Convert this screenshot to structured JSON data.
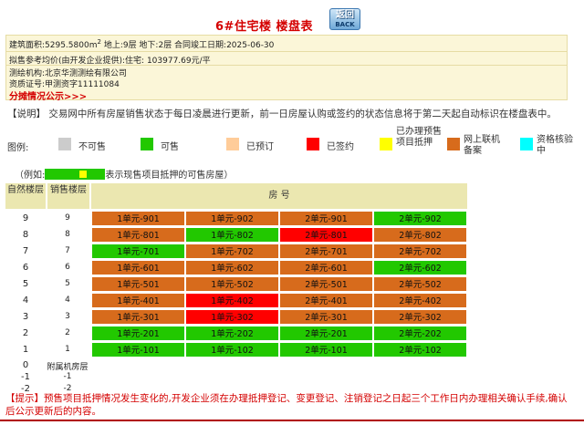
{
  "header": {
    "title": "6#住宅楼  楼盘表",
    "back_top": "返回",
    "back_bottom": "BACK"
  },
  "info": {
    "area_prefix": "建筑面积:5295.5800m",
    "area_sup": "2",
    "area_suffix": "  地上:9层  地下:2层  合同竣工日期:2025-06-30",
    "price": "拟售参考均价(由开发企业提供):住宅:  103977.69元/平",
    "agency": "测绘机构:北京华测测绘有限公司",
    "cert": "资质证号:甲测资字11111084",
    "link": "分摊情况公示>>>"
  },
  "note": "【说明】 交易网中所有房屋销售状态于每日凌晨进行更新，前一日房屋认购或签约的状态信息将于第二天起自动标识在楼盘表中。",
  "legend": {
    "label": "图例:",
    "items": [
      {
        "name": "不可售",
        "color": "#cccccc"
      },
      {
        "name": "可售",
        "color": "#22c800"
      },
      {
        "name": "已预订",
        "color": "#ffcc99"
      },
      {
        "name": "已签约",
        "color": "#ff0000"
      },
      {
        "name": "已办理预售项目抵押",
        "color": "#ffff00"
      },
      {
        "name": "网上联机备案",
        "color": "#d76b1c"
      },
      {
        "name": "资格核验中",
        "color": "#00ffff"
      }
    ]
  },
  "example": {
    "prefix": "（例如:",
    "suffix": "表示现售项目抵押的可售房屋）"
  },
  "table": {
    "headers": {
      "floor": "自然楼层",
      "sales": "销售楼层",
      "rooms": "房 号"
    },
    "rows": [
      {
        "floor": "9",
        "sales": "9",
        "cells": [
          {
            "label": "1单元-901",
            "status": "sold"
          },
          {
            "label": "1单元-902",
            "status": "sold"
          },
          {
            "label": "2单元-901",
            "status": "sold"
          },
          {
            "label": "2单元-902",
            "status": "avail"
          }
        ]
      },
      {
        "floor": "8",
        "sales": "8",
        "cells": [
          {
            "label": "1单元-801",
            "status": "sold"
          },
          {
            "label": "1单元-802",
            "status": "avail"
          },
          {
            "label": "2单元-801",
            "status": "signed"
          },
          {
            "label": "2单元-802",
            "status": "sold"
          }
        ]
      },
      {
        "floor": "7",
        "sales": "7",
        "cells": [
          {
            "label": "1单元-701",
            "status": "avail"
          },
          {
            "label": "1单元-702",
            "status": "sold"
          },
          {
            "label": "2单元-701",
            "status": "sold"
          },
          {
            "label": "2单元-702",
            "status": "sold"
          }
        ]
      },
      {
        "floor": "6",
        "sales": "6",
        "cells": [
          {
            "label": "1单元-601",
            "status": "sold"
          },
          {
            "label": "1单元-602",
            "status": "sold"
          },
          {
            "label": "2单元-601",
            "status": "sold"
          },
          {
            "label": "2单元-602",
            "status": "avail"
          }
        ]
      },
      {
        "floor": "5",
        "sales": "5",
        "cells": [
          {
            "label": "1单元-501",
            "status": "sold"
          },
          {
            "label": "1单元-502",
            "status": "sold"
          },
          {
            "label": "2单元-501",
            "status": "sold"
          },
          {
            "label": "2单元-502",
            "status": "sold"
          }
        ]
      },
      {
        "floor": "4",
        "sales": "4",
        "cells": [
          {
            "label": "1单元-401",
            "status": "sold"
          },
          {
            "label": "1单元-402",
            "status": "signed"
          },
          {
            "label": "2单元-401",
            "status": "sold"
          },
          {
            "label": "2单元-402",
            "status": "sold"
          }
        ]
      },
      {
        "floor": "3",
        "sales": "3",
        "cells": [
          {
            "label": "1单元-301",
            "status": "sold"
          },
          {
            "label": "1单元-302",
            "status": "signed"
          },
          {
            "label": "2单元-301",
            "status": "sold"
          },
          {
            "label": "2单元-302",
            "status": "sold"
          }
        ]
      },
      {
        "floor": "2",
        "sales": "2",
        "cells": [
          {
            "label": "1单元-201",
            "status": "avail"
          },
          {
            "label": "1单元-202",
            "status": "avail"
          },
          {
            "label": "2单元-201",
            "status": "avail"
          },
          {
            "label": "2单元-202",
            "status": "avail"
          }
        ]
      },
      {
        "floor": "1",
        "sales": "1",
        "cells": [
          {
            "label": "1单元-101",
            "status": "avail"
          },
          {
            "label": "1单元-102",
            "status": "avail"
          },
          {
            "label": "2单元-101",
            "status": "avail"
          },
          {
            "label": "2单元-102",
            "status": "avail"
          }
        ]
      }
    ],
    "basement": [
      {
        "floor": "0",
        "sales": "附属机房层"
      },
      {
        "floor": "-1",
        "sales": "-1"
      },
      {
        "floor": "-2",
        "sales": "-2"
      }
    ]
  },
  "tip": "【提示】预售项目抵押情况发生变化的,开发企业须在办理抵押登记、变更登记、注销登记之日起三个工作日内办理相关确认手续,确认后公示更新后的内容。"
}
